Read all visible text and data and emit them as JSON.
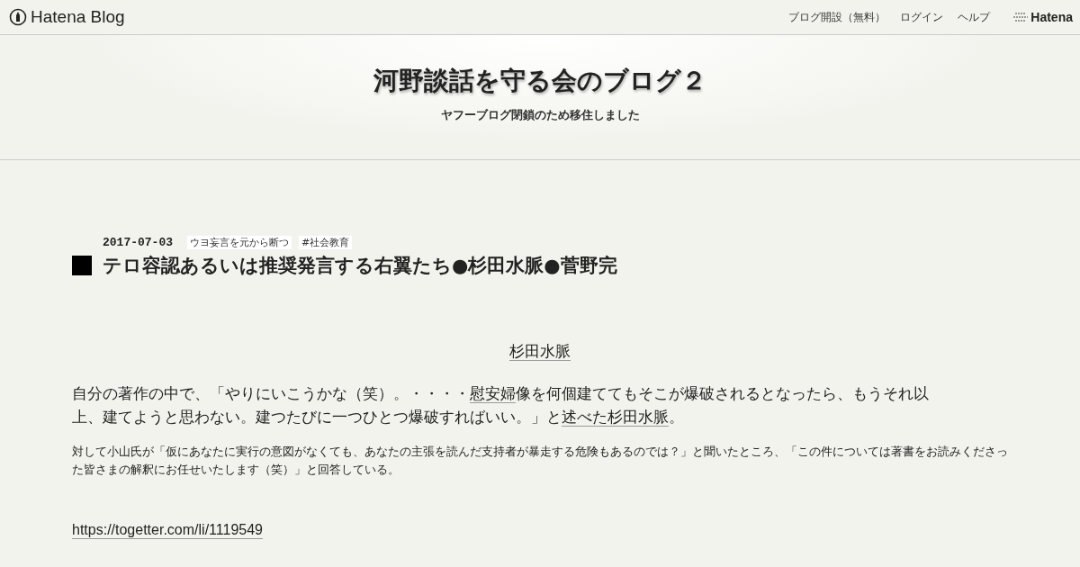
{
  "header": {
    "logo": "Hatena Blog",
    "nav": [
      "ブログ開設（無料）",
      "ログイン",
      "ヘルプ"
    ],
    "brand": "Hatena"
  },
  "blog": {
    "title": "河野談話を守る会のブログ２",
    "description": "ヤフーブログ閉鎖のため移住しました"
  },
  "entry": {
    "date": "2017-07-03",
    "categories": [
      "ウヨ妄言を元から断つ",
      "#社会教育"
    ],
    "title": "テロ容認あるいは推奨発言する右翼たち●杉田水脈●菅野完",
    "name_link": "杉田水脈",
    "paragraph": [
      {
        "text": "自分の著作の中で、「やりにいこうかな（笑）。・・・・",
        "link": false
      },
      {
        "text": "慰安婦",
        "link": true
      },
      {
        "text": "像を何個建ててもそこが爆破されるとなったら、もうそれ以上、建てようと思わない。建つたびに一つひとつ爆破すればいい。」と",
        "link": false
      },
      {
        "text": "述べた",
        "link": true
      },
      {
        "text": "杉田水脈",
        "link": true
      },
      {
        "text": "。",
        "link": false
      }
    ],
    "note": "対して小山氏が「仮にあなたに実行の意図がなくても、あなたの主張を読んだ支持者が暴走する危険もあるのでは？」と聞いたところ、「この件については著書をお読みくださった皆さまの解釈にお任せいたします（笑）」と回答している。",
    "url": "https://togetter.com/li/1119549"
  }
}
